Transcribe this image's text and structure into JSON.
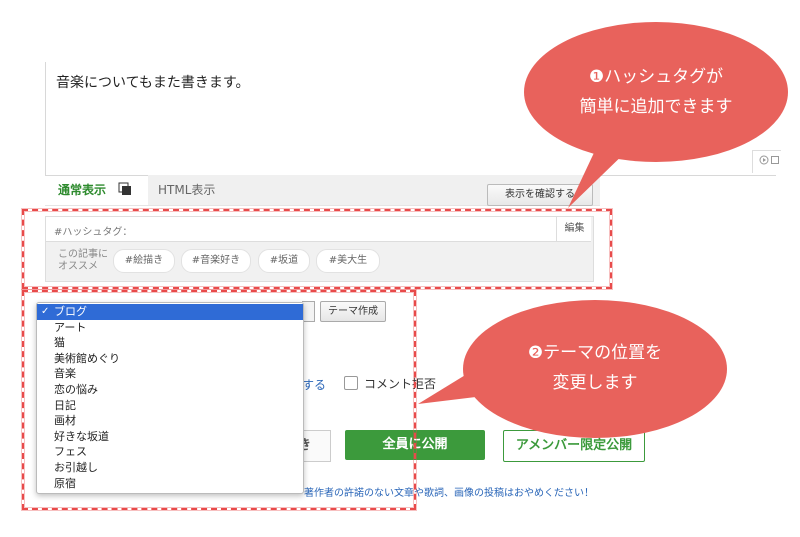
{
  "editor": {
    "body_text": "音楽についてもまた書きます。"
  },
  "mode_tabs": {
    "normal_label": "通常表示",
    "html_label": "HTML表示",
    "preview_button": "表示を確認する"
  },
  "hashtag": {
    "label": "#ハッシュタグ：",
    "edit_label": "編集",
    "suggest_label_line1": "この記事に",
    "suggest_label_line2": "オススメ",
    "chips": [
      "#絵描き",
      "#音楽好き",
      "#坂道",
      "#美大生"
    ]
  },
  "theme": {
    "options": [
      "ブログ",
      "アート",
      "猫",
      "美術館めぐり",
      "音楽",
      "恋の悩み",
      "日記",
      "画材",
      "好きな坂道",
      "フェス",
      "お引越し",
      "原宿"
    ],
    "selected_index": 0,
    "check_mark": "✓",
    "create_button": "テーマ作成"
  },
  "options_row": {
    "partial_link": "する",
    "comment_label": "コメント拒否"
  },
  "publish": {
    "stub_label": "き",
    "public_button": "全員に公開",
    "member_button": "アメンバー限定公開",
    "notice": "著作者の許諾のない文章や歌詞、画像の投稿はおやめください！"
  },
  "callouts": {
    "callout1_line1": "❶ハッシュタグが",
    "callout1_line2": "簡単に追加できます",
    "callout2_line1": "❷テーマの位置を",
    "callout2_line2": "変更します"
  },
  "colors": {
    "callout": "#e8625c",
    "frame": "#e84a4a",
    "accent_green": "#3c9a3c",
    "link_blue": "#2a66b8",
    "selection": "#2f6bd6"
  },
  "icons": [
    "toggle-view-icon",
    "play-circle-icon",
    "square-icon",
    "checkmark-icon"
  ]
}
